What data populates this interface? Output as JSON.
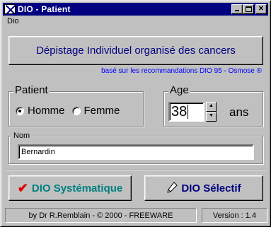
{
  "window": {
    "title": "DIO - Patient"
  },
  "menu": {
    "items": [
      "Dio"
    ]
  },
  "banner": {
    "title": "Dépistage Individuel organisé des cancers",
    "subtitle": "basé sur les recommandations DIO 95 - Osmose ®"
  },
  "patient": {
    "label": "Patient",
    "options": [
      "Homme",
      "Femme"
    ],
    "selected": "Homme"
  },
  "age": {
    "label": "Age",
    "value": "38",
    "unit": "ans"
  },
  "nom": {
    "label": "Nom",
    "value": "Bernardin"
  },
  "buttons": {
    "systematique": "DIO Systématique",
    "selectif": "DIO Sélectif"
  },
  "status": {
    "credits": "by Dr R.Remblain - © 2000 - FREEWARE",
    "version": "Version : 1.4"
  },
  "colors": {
    "titlebar": "#000080",
    "banner_text": "#000080",
    "subtitle": "#0000ff",
    "sys_button": "#008080",
    "check": "#e00000"
  }
}
